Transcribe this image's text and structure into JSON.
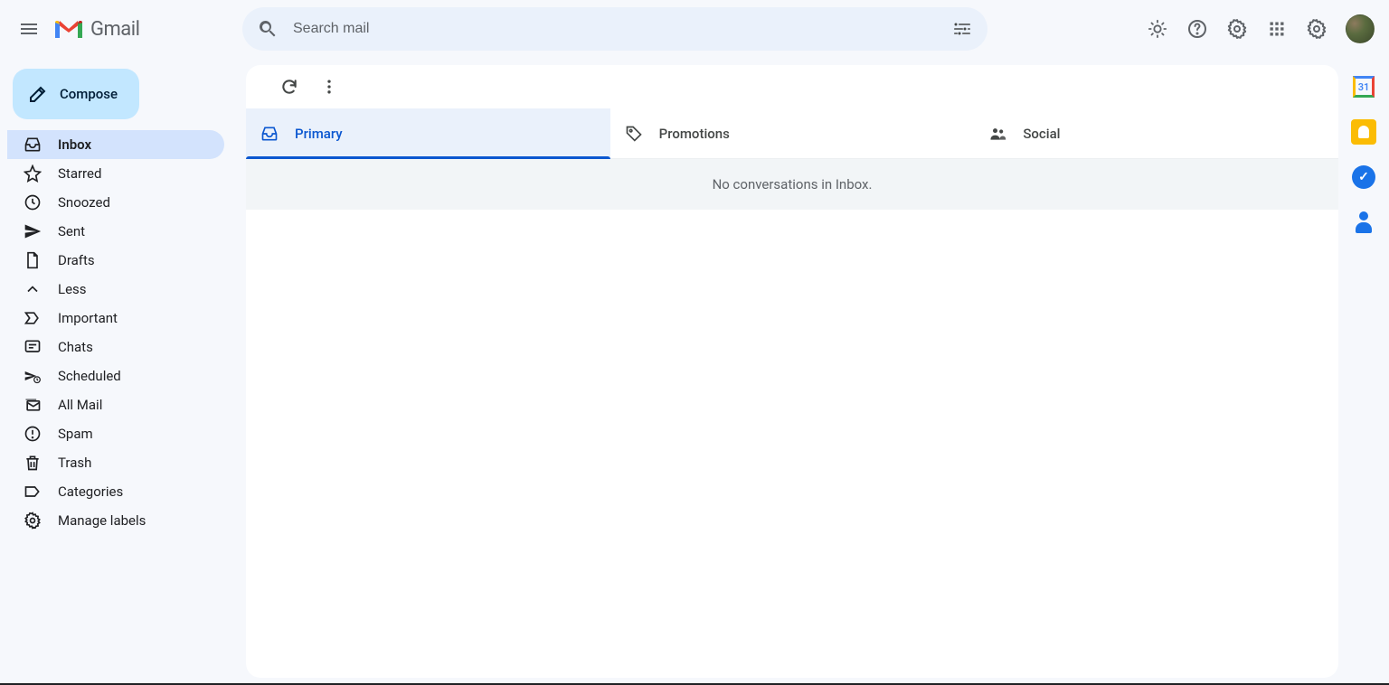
{
  "app": {
    "name": "Gmail"
  },
  "search": {
    "placeholder": "Search mail"
  },
  "compose": {
    "label": "Compose"
  },
  "sidebar": {
    "items": [
      {
        "label": "Inbox",
        "icon": "inbox",
        "active": true
      },
      {
        "label": "Starred",
        "icon": "star",
        "active": false
      },
      {
        "label": "Snoozed",
        "icon": "clock",
        "active": false
      },
      {
        "label": "Sent",
        "icon": "send",
        "active": false
      },
      {
        "label": "Drafts",
        "icon": "file",
        "active": false
      },
      {
        "label": "Less",
        "icon": "chevron-up",
        "active": false
      },
      {
        "label": "Important",
        "icon": "important",
        "active": false
      },
      {
        "label": "Chats",
        "icon": "chat",
        "active": false
      },
      {
        "label": "Scheduled",
        "icon": "schedule",
        "active": false
      },
      {
        "label": "All Mail",
        "icon": "all-mail",
        "active": false
      },
      {
        "label": "Spam",
        "icon": "spam",
        "active": false
      },
      {
        "label": "Trash",
        "icon": "trash",
        "active": false
      },
      {
        "label": "Categories",
        "icon": "label",
        "active": false
      },
      {
        "label": "Manage labels",
        "icon": "gear",
        "active": false
      }
    ]
  },
  "tabs": [
    {
      "label": "Primary",
      "icon": "inbox",
      "active": true
    },
    {
      "label": "Promotions",
      "icon": "tag",
      "active": false
    },
    {
      "label": "Social",
      "icon": "people",
      "active": false
    }
  ],
  "main": {
    "empty_text": "No conversations in Inbox."
  },
  "calendar": {
    "day": "31"
  },
  "colors": {
    "bg": "#f6f8fc",
    "surface": "#ffffff",
    "search_bg": "#eaf1fb",
    "compose_bg": "#c2e7ff",
    "nav_active_bg": "#d3e3fd",
    "accent": "#0b57d0",
    "text_secondary": "#5f6368"
  }
}
